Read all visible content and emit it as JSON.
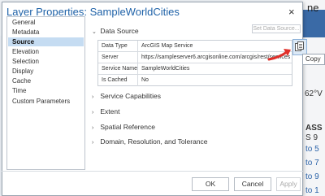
{
  "background": {
    "top_fragment": "ne",
    "right_values": [
      "62°V",
      "ASS",
      "S 9",
      "to 5",
      "to 7",
      "to 9",
      "to 1"
    ]
  },
  "dialog": {
    "title": "Layer Properties: SampleWorldCities",
    "close_glyph": "×",
    "sidebar": {
      "items": [
        {
          "label": "General",
          "selected": false
        },
        {
          "label": "Metadata",
          "selected": false
        },
        {
          "label": "Source",
          "selected": true
        },
        {
          "label": "Elevation",
          "selected": false
        },
        {
          "label": "Selection",
          "selected": false
        },
        {
          "label": "Display",
          "selected": false
        },
        {
          "label": "Cache",
          "selected": false
        },
        {
          "label": "Time",
          "selected": false
        },
        {
          "label": "Custom Parameters",
          "selected": false
        }
      ]
    },
    "data_source": {
      "heading": "Data Source",
      "expanded": true,
      "set_button": "Set Data Source...",
      "rows": [
        {
          "label": "Data Type",
          "value": "ArcGIS Map Service"
        },
        {
          "label": "Server",
          "value": "https://sampleserver6.arcgisonline.com/arcgis/rest/services"
        },
        {
          "label": "Service Name",
          "value": "SampleWorldCities"
        },
        {
          "label": "Is Cached",
          "value": "No"
        }
      ],
      "copy_tooltip": "Copy"
    },
    "sections": [
      {
        "label": "Service Capabilities",
        "expanded": false
      },
      {
        "label": "Extent",
        "expanded": false
      },
      {
        "label": "Spatial Reference",
        "expanded": false
      },
      {
        "label": "Domain, Resolution, and Tolerance",
        "expanded": false
      }
    ],
    "chevrons": {
      "expanded": "⌄",
      "collapsed": "›"
    },
    "buttons": {
      "ok": "OK",
      "cancel": "Cancel",
      "apply": "Apply"
    }
  }
}
